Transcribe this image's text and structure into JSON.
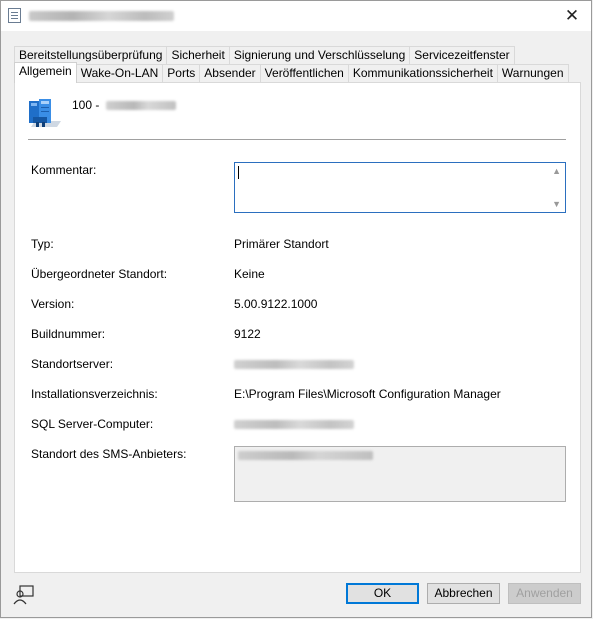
{
  "window": {
    "close_glyph": "✕"
  },
  "tabs": {
    "top": [
      "Bereitstellungsüberprüfung",
      "Sicherheit",
      "Signierung und Verschlüsselung",
      "Servicezeitfenster"
    ],
    "bottom": [
      "Allgemein",
      "Wake-On-LAN",
      "Ports",
      "Absender",
      "Veröffentlichen",
      "Kommunikationssicherheit",
      "Warnungen"
    ],
    "active": "Allgemein"
  },
  "header": {
    "site_code_prefix": "100 -",
    "icon": "server-site-icon"
  },
  "form": {
    "comment_label": "Kommentar:",
    "comment_value": "",
    "type_label": "Typ:",
    "type_value": "Primärer Standort",
    "parent_label": "Übergeordneter Standort:",
    "parent_value": "Keine",
    "version_label": "Version:",
    "version_value": "5.00.9122.1000",
    "build_label": "Buildnummer:",
    "build_value": "9122",
    "server_label": "Standortserver:",
    "install_label": "Installationsverzeichnis:",
    "install_value": "E:\\Program Files\\Microsoft Configuration Manager",
    "sql_label": "SQL Server-Computer:",
    "provider_label": "Standort des SMS-Anbieters:"
  },
  "buttons": {
    "ok": "OK",
    "cancel": "Abbrechen",
    "apply": "Anwenden"
  },
  "colors": {
    "accent": "#0078d7",
    "panel": "#ffffff",
    "dialog": "#f0f0f0"
  }
}
